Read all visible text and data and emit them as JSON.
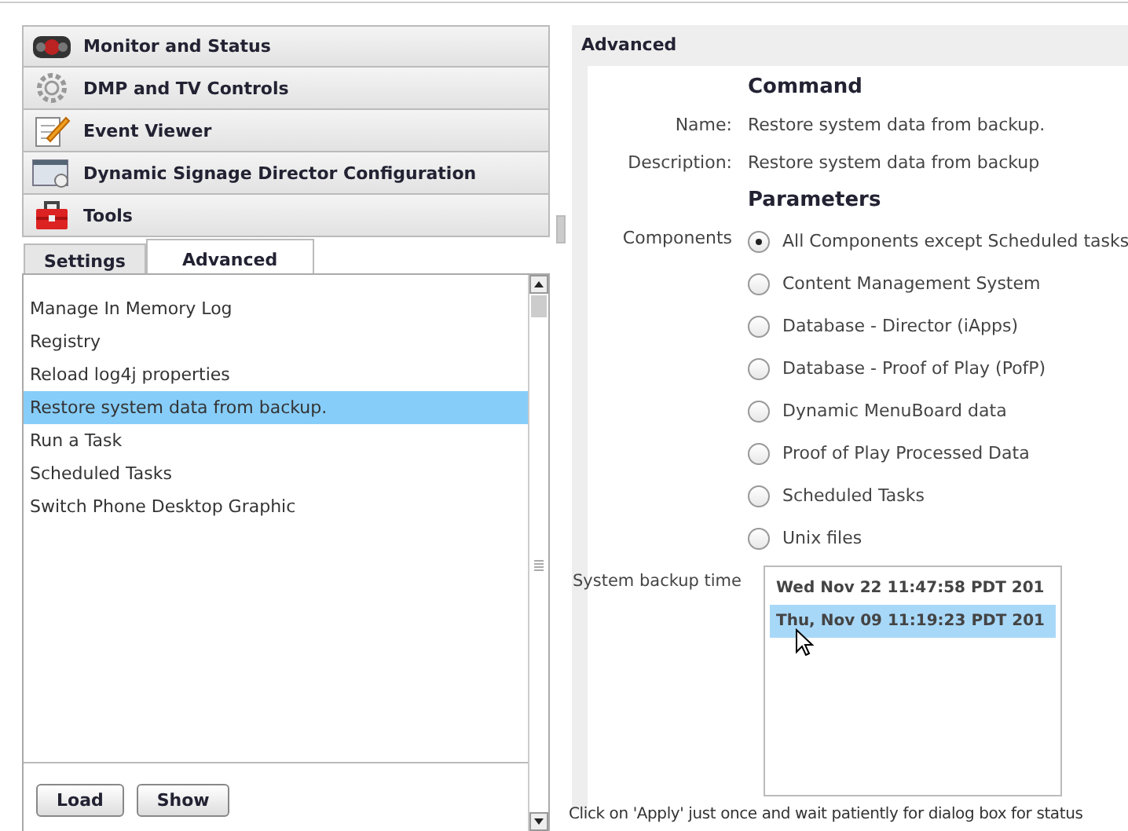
{
  "nav": [
    {
      "label": "Monitor and Status"
    },
    {
      "label": "DMP and TV Controls"
    },
    {
      "label": "Event Viewer"
    },
    {
      "label": "Dynamic Signage Director Configuration"
    },
    {
      "label": "Tools"
    }
  ],
  "tabs": [
    {
      "label": "Settings",
      "selected": false
    },
    {
      "label": "Advanced",
      "selected": true
    }
  ],
  "commands": [
    {
      "label": "Manage In Memory Log",
      "selected": false
    },
    {
      "label": "Registry",
      "selected": false
    },
    {
      "label": "Reload log4j properties",
      "selected": false
    },
    {
      "label": "Restore system data from backup.",
      "selected": true
    },
    {
      "label": "Run a Task",
      "selected": false
    },
    {
      "label": "Scheduled Tasks",
      "selected": false
    },
    {
      "label": "Switch Phone Desktop Graphic",
      "selected": false
    }
  ],
  "buttons": [
    "Load",
    "Show"
  ],
  "panel": {
    "title": "Advanced",
    "command_heading": "Command",
    "fields": [
      {
        "label": "Name:",
        "value": "Restore system data from backup."
      },
      {
        "label": "Description:",
        "value": "Restore system data from backup"
      }
    ],
    "parameters_heading": "Parameters",
    "components_label": "Components",
    "components": [
      {
        "label": "All Components except Scheduled tasks",
        "selected": true
      },
      {
        "label": "Content Management System",
        "selected": false
      },
      {
        "label": "Database - Director (iApps)",
        "selected": false
      },
      {
        "label": "Database - Proof of Play (PofP)",
        "selected": false
      },
      {
        "label": "Dynamic MenuBoard data",
        "selected": false
      },
      {
        "label": "Proof of Play Processed Data",
        "selected": false
      },
      {
        "label": "Scheduled Tasks",
        "selected": false
      },
      {
        "label": "Unix files",
        "selected": false
      }
    ],
    "backup_label": "System backup time",
    "backup_times": [
      {
        "text": "Wed Nov 22 11:47:58 PDT 201",
        "selected": false
      },
      {
        "text": "Thu, Nov 09 11:19:23 PDT 201",
        "selected": true
      }
    ],
    "note": "Click on 'Apply' just once and wait patiently for dialog box for status"
  }
}
